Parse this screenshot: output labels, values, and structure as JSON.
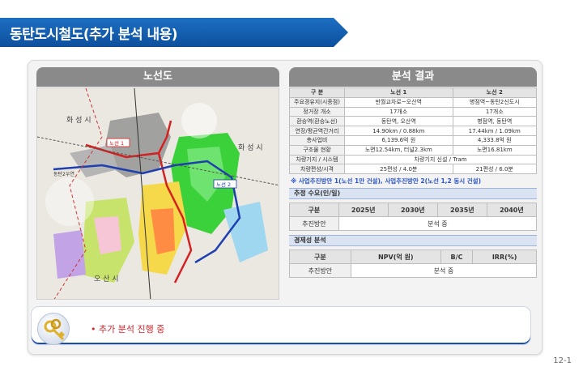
{
  "header": {
    "title": "동탄도시철도(추가 분석 내용)"
  },
  "map_section": {
    "heading": "노선도",
    "labels": {
      "hwaseong_left": "화 성 시",
      "hwaseong_right": "화 성 시",
      "osan": "오 산 시",
      "line1": "노선 1",
      "line2": "노선 2",
      "station": "동탄2우연"
    }
  },
  "result_section": {
    "heading": "분석 결과",
    "table": {
      "headers": [
        "구 분",
        "노선 1",
        "노선 2"
      ],
      "rows": [
        [
          "주요경유지(시종점)",
          "반월교차로~오산역",
          "병점역~동탄2신도시"
        ],
        [
          "정거장 개소",
          "17개소",
          "17개소"
        ],
        [
          "환승역(환승노선)",
          "동탄역, 오산역",
          "병점역, 동탄역"
        ],
        [
          "연장/평균역간거리",
          "14.90km / 0.88km",
          "17.44km / 1.09km"
        ],
        [
          "총사업비",
          "6,139.6억  원",
          "4,333.8억  원"
        ],
        [
          "구조물 현황",
          "노면12.54km, 터널2.3km",
          "노면16.81km"
        ],
        [
          "차량기지 / 시스템",
          "차량기지 신설 / Tram",
          ""
        ],
        [
          "차량편성/시격",
          "25편성  /  4.0분",
          "21편성  /  6.0분"
        ]
      ]
    },
    "note": "※ 사업추진방안 1(노선 1만 건설), 사업추진방안 2(노선 1,2 동시 건설)",
    "demand": {
      "title": "추정 수요(인/일)",
      "headers": [
        "구분",
        "2025년",
        "2030년",
        "2035년",
        "2040년"
      ],
      "row_label": "추진방안",
      "row_value": "분석 중"
    },
    "economy": {
      "title": "경제성 분석",
      "headers": [
        "구분",
        "NPV(억 원)",
        "B/C",
        "IRR(%)"
      ],
      "row_label": "추진방안",
      "row_value": "분석 중"
    }
  },
  "bottom": {
    "bullet": "•  추가 분석 진행 중"
  },
  "footer": {
    "page": "12-1"
  },
  "colors": {
    "title_blue": "#1565c0",
    "section_gray": "#8a8a8a",
    "note_blue": "#2b55c9",
    "bullet_red": "#d2232a",
    "line1_red": "#d42020",
    "line2_blue": "#1f3fb0"
  }
}
